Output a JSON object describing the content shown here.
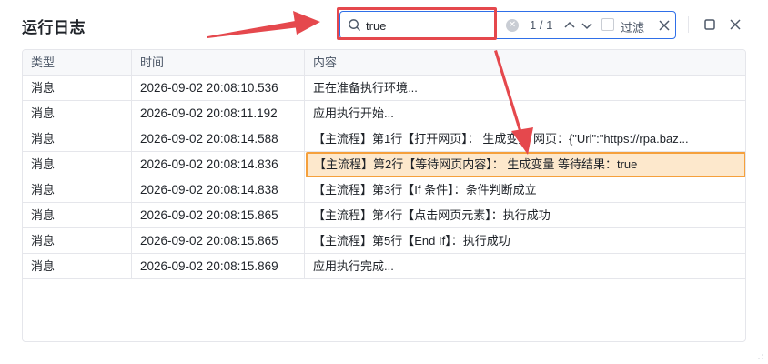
{
  "window": {
    "title": "运行日志"
  },
  "search": {
    "value": "true",
    "match_count": "1 / 1",
    "filter_label": "过滤",
    "filter_checked": false
  },
  "table": {
    "columns": [
      "类型",
      "时间",
      "内容"
    ],
    "rows": [
      {
        "type": "消息",
        "time": "2026-09-02 20:08:10.536",
        "content": "正在准备执行环境..."
      },
      {
        "type": "消息",
        "time": "2026-09-02 20:08:11.192",
        "content": "应用执行开始..."
      },
      {
        "type": "消息",
        "time": "2026-09-02 20:08:14.588",
        "content": "【主流程】第1行【打开网页】： 生成变量 网页：{\"Url\":\"https://rpa.baz..."
      },
      {
        "type": "消息",
        "time": "2026-09-02 20:08:14.836",
        "content": "【主流程】第2行【等待网页内容】： 生成变量 等待结果：true",
        "highlighted": true
      },
      {
        "type": "消息",
        "time": "2026-09-02 20:08:14.838",
        "content": "【主流程】第3行【If 条件】：条件判断成立"
      },
      {
        "type": "消息",
        "time": "2026-09-02 20:08:15.865",
        "content": "【主流程】第4行【点击网页元素】：执行成功"
      },
      {
        "type": "消息",
        "time": "2026-09-02 20:08:15.865",
        "content": "【主流程】第5行【End If】：执行成功"
      },
      {
        "type": "消息",
        "time": "2026-09-02 20:08:15.869",
        "content": "应用执行完成..."
      }
    ]
  },
  "colors": {
    "accent": "#2f6fe8",
    "annotation_red": "#e5484d",
    "highlight_fill": "#fde8cc",
    "highlight_border": "#f5a03c"
  }
}
